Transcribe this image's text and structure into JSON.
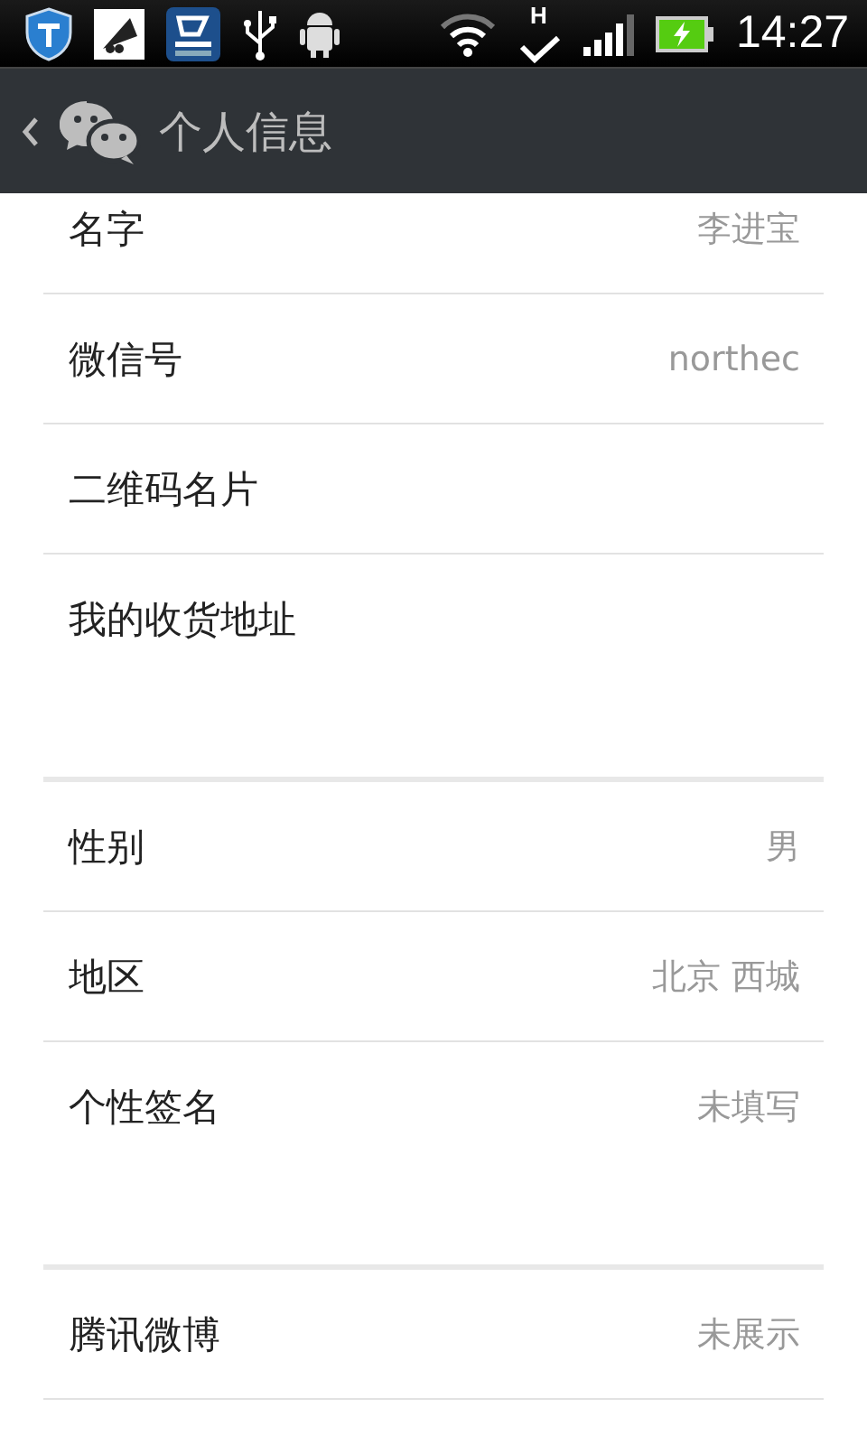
{
  "status_bar": {
    "network_type": "H",
    "time": "14:27"
  },
  "header": {
    "title": "个人信息"
  },
  "sections": [
    {
      "rows": [
        {
          "label": "名字",
          "value": "李进宝"
        },
        {
          "label": "微信号",
          "value": "northec"
        },
        {
          "label": "二维码名片"
        },
        {
          "label": "我的收货地址"
        }
      ]
    },
    {
      "rows": [
        {
          "label": "性别",
          "value": "男"
        },
        {
          "label": "地区",
          "value": "北京 西城"
        },
        {
          "label": "个性签名",
          "value": "未填写"
        }
      ]
    },
    {
      "rows": [
        {
          "label": "腾讯微博",
          "value": "未展示"
        }
      ]
    }
  ]
}
